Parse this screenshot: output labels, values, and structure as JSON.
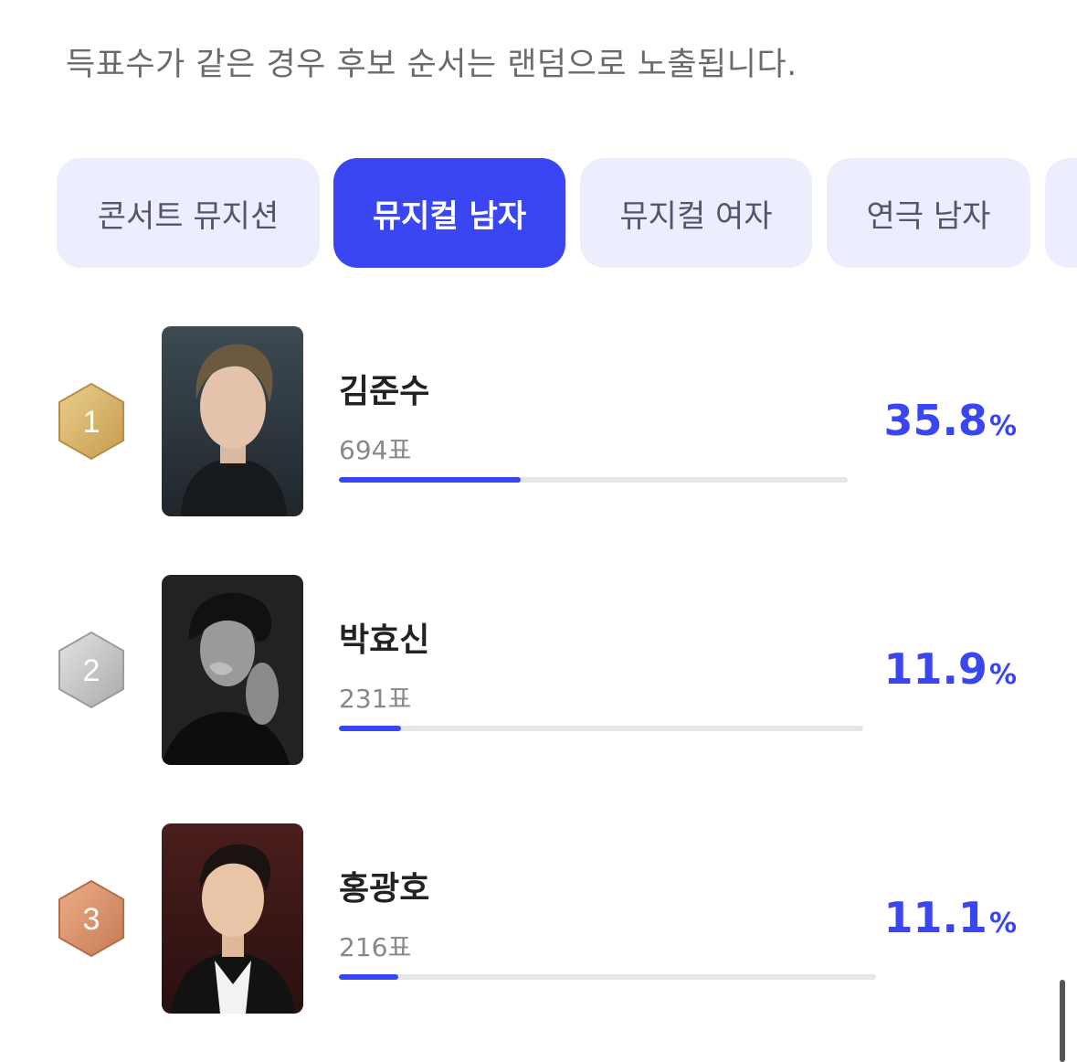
{
  "notice": "득표수가 같은 경우 후보 순서는 랜덤으로 노출됩니다.",
  "tabs": [
    {
      "label": "콘서트 뮤지션",
      "active": false
    },
    {
      "label": "뮤지컬 남자",
      "active": true
    },
    {
      "label": "뮤지컬 여자",
      "active": false
    },
    {
      "label": "연극 남자",
      "active": false
    }
  ],
  "candidates": [
    {
      "rank": "1",
      "medal": "gold",
      "name": "김준수",
      "votes": "694표",
      "percent": "35.8",
      "percent_symbol": "%",
      "share": 0.358
    },
    {
      "rank": "2",
      "medal": "silver",
      "name": "박효신",
      "votes": "231표",
      "percent": "11.9",
      "percent_symbol": "%",
      "share": 0.119
    },
    {
      "rank": "3",
      "medal": "bronze",
      "name": "홍광호",
      "votes": "216표",
      "percent": "11.1",
      "percent_symbol": "%",
      "share": 0.111
    }
  ],
  "colors": {
    "accent": "#3a46f2",
    "tab_inactive_bg": "#eceefd",
    "gold": "#d6b46c",
    "silver": "#bdbdbd",
    "bronze": "#d9916a"
  }
}
